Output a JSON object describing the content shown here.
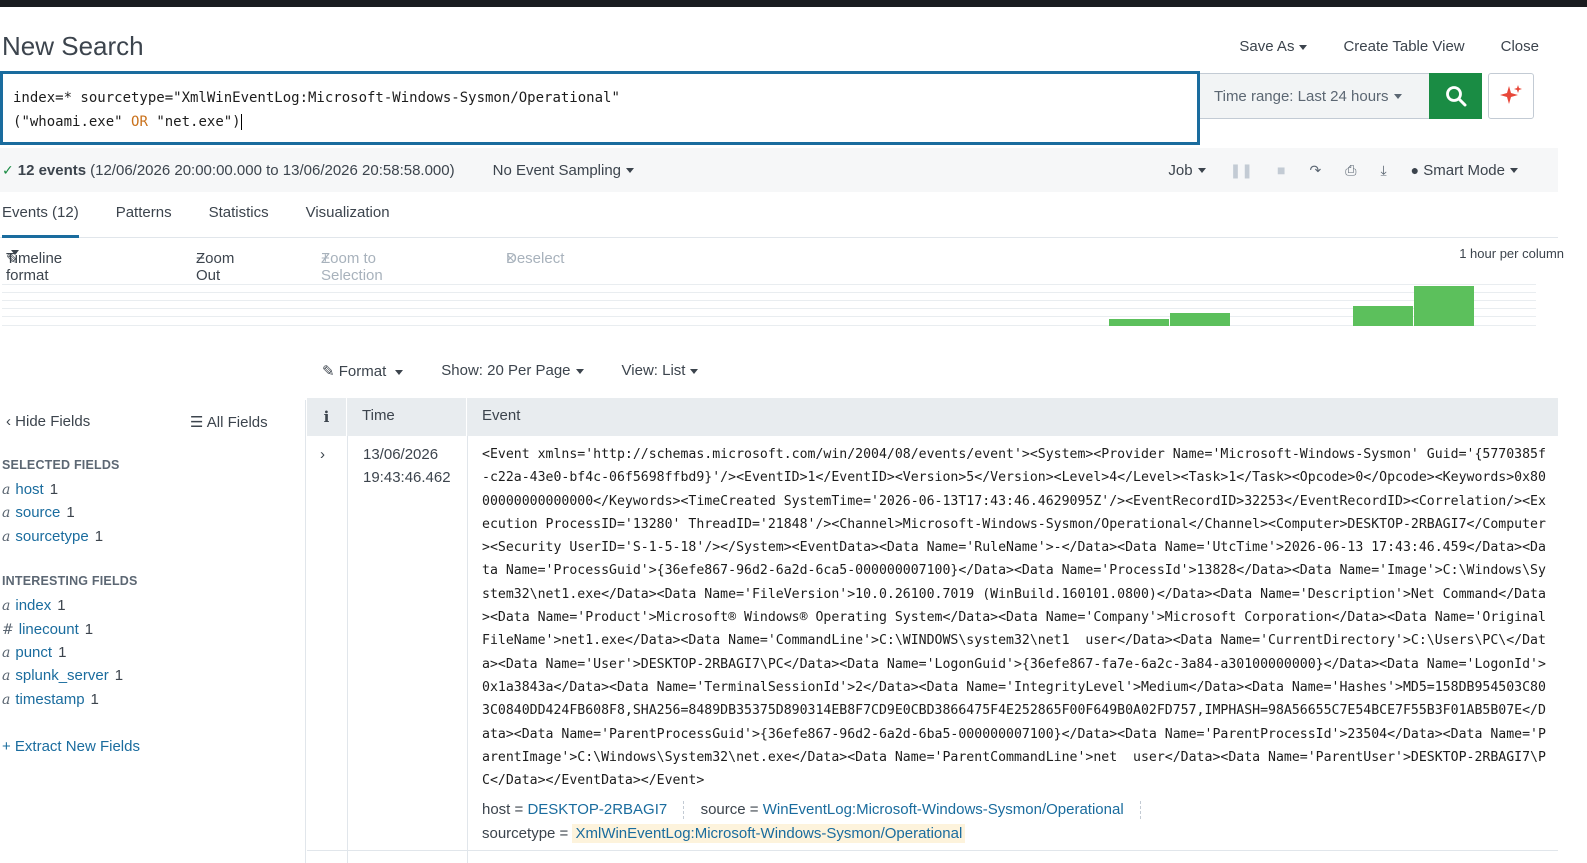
{
  "header": {
    "title": "New Search",
    "save_as": "Save As",
    "create_table_view": "Create Table View",
    "close": "Close"
  },
  "search": {
    "line1": "index=* sourcetype=\"XmlWinEventLog:Microsoft-Windows-Sysmon/Operational\"",
    "line2_open": "(",
    "line2_a": "\"whoami.exe\"",
    "line2_or": "OR",
    "line2_b": "\"net.exe\")",
    "time_range": "Time range: Last 24 hours"
  },
  "status": {
    "check": "✓",
    "count": "12 events",
    "range": "(12/06/2026 20:00:00.000 to 13/06/2026 20:58:58.000)",
    "sampling": "No Event Sampling",
    "job": "Job",
    "mode": "Smart Mode"
  },
  "tabs": [
    "Events (12)",
    "Patterns",
    "Statistics",
    "Visualization"
  ],
  "timeline": {
    "format": "Timeline format",
    "zoom_out": "Zoom Out",
    "zoom_selection": "Zoom to Selection",
    "deselect": "Deselect",
    "per_column": "1 hour per column",
    "bar_color": "#5cc05c"
  },
  "chart_data": {
    "type": "bar",
    "bars": [
      {
        "column": 18,
        "value": 1
      },
      {
        "column": 19,
        "value": 2
      },
      {
        "column": 22,
        "value": 3
      },
      {
        "column": 23,
        "value": 6
      }
    ],
    "columns": 25,
    "max": 6
  },
  "results_tools": {
    "format": "Format",
    "show": "Show: 20 Per Page",
    "view": "View: List"
  },
  "sidebar": {
    "hide_fields": "Hide Fields",
    "all_fields": "All Fields",
    "selected_title": "SELECTED FIELDS",
    "selected": [
      {
        "type": "a",
        "name": "host",
        "count": "1"
      },
      {
        "type": "a",
        "name": "source",
        "count": "1"
      },
      {
        "type": "a",
        "name": "sourcetype",
        "count": "1"
      }
    ],
    "interesting_title": "INTERESTING FIELDS",
    "interesting": [
      {
        "type": "a",
        "name": "index",
        "count": "1"
      },
      {
        "type": "#",
        "name": "linecount",
        "count": "1"
      },
      {
        "type": "a",
        "name": "punct",
        "count": "1"
      },
      {
        "type": "a",
        "name": "splunk_server",
        "count": "1"
      },
      {
        "type": "a",
        "name": "timestamp",
        "count": "1"
      }
    ],
    "extract": "+ Extract New Fields"
  },
  "table": {
    "col_i": "i",
    "col_time": "Time",
    "col_event": "Event",
    "rows": [
      {
        "expander": "›",
        "date": "13/06/2026",
        "time": "19:43:46.462",
        "event": "<Event xmlns='http://schemas.microsoft.com/win/2004/08/events/event'><System><Provider Name='Microsoft-Windows-Sysmon' Guid='{5770385f-c22a-43e0-bf4c-06f5698ffbd9}'/><EventID>1</EventID><Version>5</Version><Level>4</Level><Task>1</Task><Opcode>0</Opcode><Keywords>0x8000000000000000</Keywords><TimeCreated SystemTime='2026-06-13T17:43:46.4629095Z'/><EventRecordID>32253</EventRecordID><Correlation/><Execution ProcessID='13280' ThreadID='21848'/><Channel>Microsoft-Windows-Sysmon/Operational</Channel><Computer>DESKTOP-2RBAGI7</Computer><Security UserID='S-1-5-18'/></System><EventData><Data Name='RuleName'>-</Data><Data Name='UtcTime'>2026-06-13 17:43:46.459</Data><Data Name='ProcessGuid'>{36efe867-96d2-6a2d-6ca5-000000007100}</Data><Data Name='ProcessId'>13828</Data><Data Name='Image'>C:\\Windows\\System32\\net1.exe</Data><Data Name='FileVersion'>10.0.26100.7019 (WinBuild.160101.0800)</Data><Data Name='Description'>Net Command</Data><Data Name='Product'>Microsoft® Windows® Operating System</Data><Data Name='Company'>Microsoft Corporation</Data><Data Name='OriginalFileName'>net1.exe</Data><Data Name='CommandLine'>C:\\WINDOWS\\system32\\net1  user</Data><Data Name='CurrentDirectory'>C:\\Users\\PC\\</Data><Data Name='User'>DESKTOP-2RBAGI7\\PC</Data><Data Name='LogonGuid'>{36efe867-fa7e-6a2c-3a84-a30100000000}</Data><Data Name='LogonId'>0x1a3843a</Data><Data Name='TerminalSessionId'>2</Data><Data Name='IntegrityLevel'>Medium</Data><Data Name='Hashes'>MD5=158DB954503C803C0840DD424FB608F8,SHA256=8489DB35375D890314EB8F7CD9E0CBD3866475F4E252865F00F649B0A02FD757,IMPHASH=98A56655C7E54BCE7F55B3F01AB5B07E</Data><Data Name='ParentProcessGuid'>{36efe867-96d2-6a2d-6ba5-000000007100}</Data><Data Name='ParentProcessId'>23504</Data><Data Name='ParentImage'>C:\\Windows\\System32\\net.exe</Data><Data Name='ParentCommandLine'>net  user</Data><Data Name='ParentUser'>DESKTOP-2RBAGI7\\PC</Data></EventData></Event>",
        "host_label": "host =",
        "host": "DESKTOP-2RBAGI7",
        "source_label": "source =",
        "source": "WinEventLog:Microsoft-Windows-Sysmon/Operational",
        "sourcetype_label": "sourcetype =",
        "sourcetype": "XmlWinEventLog:Microsoft-Windows-Sysmon/Operational"
      }
    ]
  },
  "colors": {
    "accent": "#1a6c9e",
    "search_green": "#1a8c44",
    "ai_red": "#e8483a"
  }
}
